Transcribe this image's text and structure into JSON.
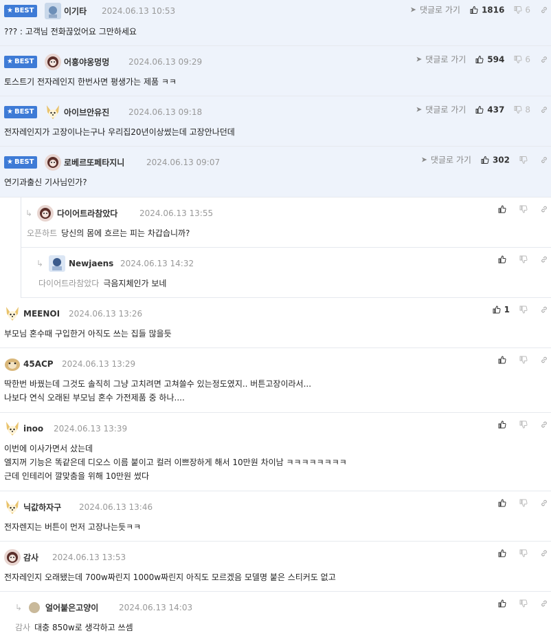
{
  "best_label": "BEST",
  "goto_label": "댓글로 가기",
  "comments": [
    {
      "name": "이기타",
      "date": "2024.06.13 10:53",
      "text": "??? : 고객님 전화끊었어요 그만하세요",
      "up": "1816",
      "down": "6"
    },
    {
      "name": "어흥야옹멍멍",
      "date": "2024.06.13 09:29",
      "text": "토스트기 전자레인지 한번사면 평생가는 제품 ㅋㅋ",
      "up": "594",
      "down": "6"
    },
    {
      "name": "아이브안유진",
      "date": "2024.06.13 09:18",
      "text": "전자레인지가 고장이나는구나 우리집20년이상썼는데 고장안나던데",
      "up": "437",
      "down": "8"
    },
    {
      "name": "로베르또페타지니",
      "date": "2024.06.13 09:07",
      "text": "연기과출신 기사님인가?",
      "up": "302",
      "down": ""
    },
    {
      "name": "다이어트라참았다",
      "date": "2024.06.13 13:55",
      "reply_to": "오픈하트",
      "text": "당신의 몸에 흐르는 피는 차갑습니까?",
      "up": "",
      "down": ""
    },
    {
      "name": "Newjaens",
      "date": "2024.06.13 14:32",
      "reply_to": "다이어트라참았다",
      "text": "극음지체인가 보네",
      "up": "",
      "down": ""
    },
    {
      "name": "MEENOI",
      "date": "2024.06.13 13:26",
      "text": "부모님 혼수때 구입한거 아직도 쓰는 집들 많을듯",
      "up": "1",
      "down": ""
    },
    {
      "name": "45ACP",
      "date": "2024.06.13 13:29",
      "text": "딱한번 바꿨는데 그것도 솔직히 그냥 고치려면 고쳐쓸수 있는정도였지.. 버튼고장이라서...\n나보다 연식 오래된 부모님 혼수 가전제품 중 하나....",
      "up": "",
      "down": ""
    },
    {
      "name": "inoo",
      "date": "2024.06.13 13:39",
      "text": "이번에 이사가면서 샀는데\n엘지꺼 기능은 똑같은데 디오스 이름 붙이고 컬러 이쁘장하게 해서 10만원 차이남 ㅋㅋㅋㅋㅋㅋㅋㅋ\n근데 인테리어 깔맞춤을 위해 10만원 썼다",
      "up": "",
      "down": ""
    },
    {
      "name": "닉값하자구",
      "date": "2024.06.13 13:46",
      "text": "전자렌지는 버튼이 먼저 고장나는듯ㅋㅋ",
      "up": "",
      "down": ""
    },
    {
      "name": "감사",
      "date": "2024.06.13 13:53",
      "text": "전자레인지 오래됐는데 700w짜린지 1000w짜린지 아직도 모르겠음 모델명 붙은 스티커도 없고",
      "up": "",
      "down": ""
    },
    {
      "name": "얼어붙은고양이",
      "date": "2024.06.13 14:03",
      "reply_to": "감사",
      "text": "대충 850w로 생각하고 쓰셈",
      "up": "",
      "down": ""
    }
  ],
  "colors": {
    "best_badge": "#3e7bd6",
    "best_bg": "#eef3fb",
    "border": "#e6e9ee"
  },
  "icons": {
    "thumb_up": "thumbs-up-icon",
    "thumb_down": "thumbs-down-icon",
    "share": "link-icon",
    "goto": "send-arrow-icon",
    "reply": "reply-arrow-icon",
    "star": "star-icon"
  }
}
